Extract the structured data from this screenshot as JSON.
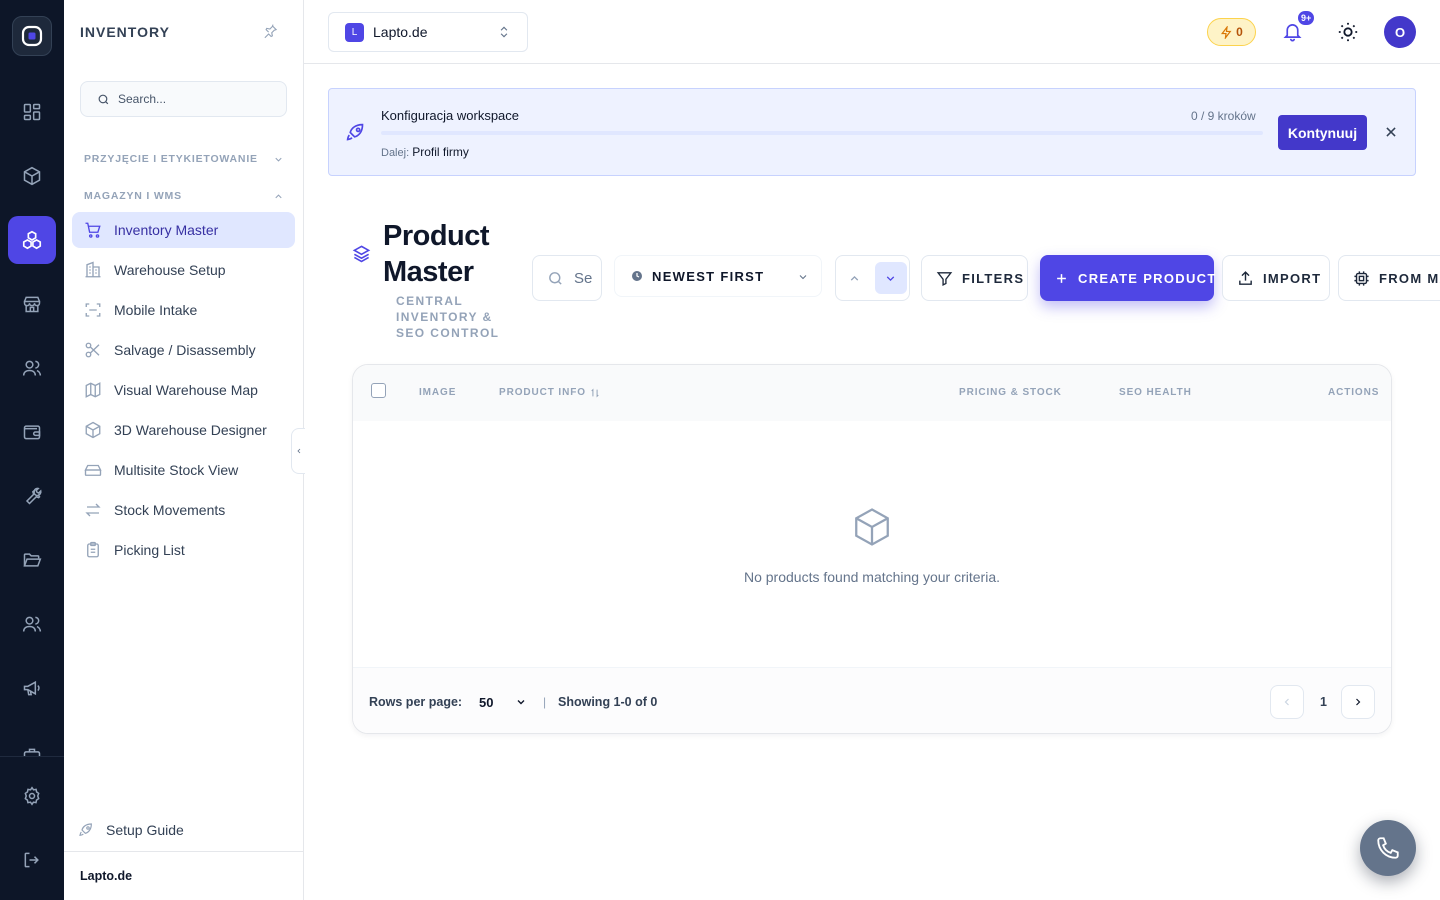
{
  "sidebar": {
    "title": "INVENTORY",
    "search_placeholder": "Search...",
    "sections": [
      {
        "label": "PRZYJĘCIE I ETYKIETOWANIE",
        "expanded": false
      },
      {
        "label": "MAGAZYN I WMS",
        "expanded": true
      }
    ],
    "items": [
      {
        "label": "Inventory Master",
        "icon": "cart-icon",
        "active": true
      },
      {
        "label": "Warehouse Setup",
        "icon": "building-icon"
      },
      {
        "label": "Mobile Intake",
        "icon": "scan-icon"
      },
      {
        "label": "Salvage / Disassembly",
        "icon": "scissors-icon"
      },
      {
        "label": "Visual Warehouse Map",
        "icon": "map-icon"
      },
      {
        "label": "3D Warehouse Designer",
        "icon": "cube-icon"
      },
      {
        "label": "Multisite Stock View",
        "icon": "hard-drive-icon"
      },
      {
        "label": "Stock Movements",
        "icon": "arrows-swap-icon"
      },
      {
        "label": "Picking List",
        "icon": "clipboard-icon"
      }
    ],
    "setup_guide": "Setup Guide",
    "footer_workspace": "Lapto.de"
  },
  "topbar": {
    "workspace_initial": "L",
    "workspace_name": "Lapto.de",
    "credits": "0",
    "notifications_badge": "9+",
    "avatar_initial": "O"
  },
  "banner": {
    "title": "Konfiguracja workspace",
    "steps": "0 / 9 kroków",
    "progress_percent": 0,
    "next_prefix": "Dalej:",
    "next_step": "Profil firmy",
    "cta": "Kontynuuj"
  },
  "page": {
    "title": "Product Master",
    "subtitle": "CENTRAL INVENTORY & SEO CONTROL"
  },
  "toolbar": {
    "search_placeholder": "Search",
    "sort_label": "NEWEST FIRST",
    "sort_direction": "descending",
    "filters_label": "FILTERS",
    "create_label": "CREATE PRODUCT",
    "import_label": "IMPORT",
    "from_label": "FROM MA"
  },
  "table": {
    "columns": [
      "IMAGE",
      "PRODUCT INFO",
      "PRICING & STOCK",
      "SEO HEALTH",
      "ACTIONS"
    ],
    "empty_message": "No products found matching your criteria.",
    "rows_per_page_label": "Rows per page:",
    "rows_per_page": "50",
    "pipe": "|",
    "showing": "Showing 1-0 of 0",
    "current_page": "1"
  },
  "colors": {
    "accent": "#4f46e5",
    "rail_bg": "#0d1628",
    "active_bg": "#e0e7ff"
  }
}
